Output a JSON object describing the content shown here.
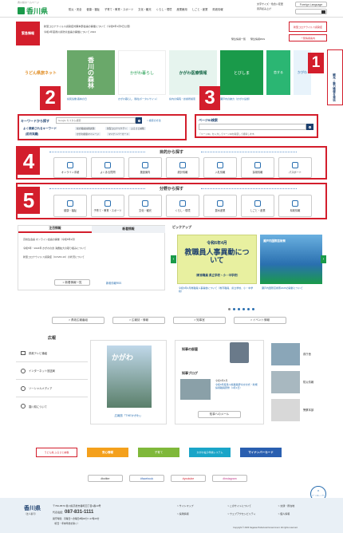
{
  "header": {
    "logo_text": "香川県",
    "site_name": "香川県ホームページ",
    "nav": [
      "防災・安全",
      "健康・福祉",
      "子育て・教育・スポーツ",
      "文化・観光",
      "くらし・環境",
      "産業雇用",
      "しごと・産業",
      "県政情報"
    ],
    "util": [
      "文字サイズ・色合い変更",
      "音声読み上げ",
      "サイトマップ"
    ],
    "lang_label": "Foreign Language",
    "search_label": "検索"
  },
  "emergency": {
    "badge": "緊急情報",
    "lines": [
      "新型コロナウイルス感染症対策本部会議の開催について（令和5年1月5日公表）",
      "令和4年度香川県防災会議の開催について 2024"
    ],
    "list_link": "緊急情報一覧",
    "rss_link": "緊急情報RSS",
    "side_button": "新型コロナウイルス感染症",
    "side_button2": "一覧情報案内"
  },
  "banners": [
    {
      "label": "うどん県旅ネット",
      "caption": "",
      "color": "#ffffff"
    },
    {
      "label": "香川の森林",
      "caption": "県民協働 森林の日",
      "color": "#6aa86a"
    },
    {
      "label": "かがわ暮らし",
      "caption": "かがわ暮らし（移住ポータルサイト）",
      "color": "#ffffff"
    },
    {
      "label": "かがわ医療情報",
      "caption": "県内の病院・診療所検索",
      "color": "#e6f4ee"
    },
    {
      "label": "とびしま",
      "caption": "瀬戸内の魅力（かがわ島旅）",
      "color": "#1a9a4a"
    },
    {
      "label": "恋する",
      "caption": "恋愛 結婚 子育てポータルサイト LOVEかがわ",
      "color": "#2bb673"
    },
    {
      "label": "かがわ",
      "caption": "ワクワクかがわ",
      "color": "#e8f3fb"
    }
  ],
  "keyword_search": {
    "title": "キーワードから探す",
    "placeholder": "Google カスタム検索",
    "hint": "> 検索の方法",
    "popular_label": "よく検索されるキーワード",
    "popular_sub": "(前月実績)",
    "popular": [
      "県の職員採用試験",
      "新型コロナワクチン",
      "ふるさと納税",
      "かがわ健康マイレージ",
      "マイナンバーカード"
    ]
  },
  "page_id_search": {
    "title": "ページID検索",
    "placeholder": "",
    "hint": "「ページID」を入力してページIDを指定して検索します。"
  },
  "purpose": {
    "title": "目的から探す",
    "items": [
      "オンライン手続",
      "よくある質問",
      "施設案内",
      "統計情報",
      "入札情報",
      "採用情報",
      "パスポート"
    ]
  },
  "field": {
    "title": "分野から探す",
    "items": [
      "健康・福祉",
      "子育て・教育・スポーツ",
      "文化・観光",
      "くらし・環境",
      "農水産業",
      "しごと・産業",
      "県政情報"
    ]
  },
  "news": {
    "tabs": [
      "注目情報",
      "新着情報"
    ],
    "items": [
      "高校生会議 オンライン会議の開催（令和5年1月）",
      "令和5年・2024年 かがわの食 消費拡大の取り組みについて",
      "新型コロナウイルス感染症（COVID-19）の状況について"
    ],
    "list_button": "> 新着情報一覧",
    "rss_button": "新着情報RSS"
  },
  "pickup": {
    "title": "ピックアップ",
    "slide_title1": "令和6年4月",
    "slide_title2": "教職員人事異動について",
    "slide_sub": "（教育職員 県立学校・小・中学校）",
    "slide_caption": "令和6年4月教職員人事異動について（教育職員、県立学校、小・中学校）",
    "slide2_caption": "瀬戸内国際芸術祭2025の開催について",
    "slide2_banner": "瀬戸内国際芸術祭",
    "tabs": [
      "> 県政広報番組",
      "> 広報誌・情報",
      "> 知事室",
      "> イベント情報"
    ]
  },
  "kouhou": {
    "title": "広報",
    "items": [
      "県政テレビ番組",
      "インターネット放送局",
      "ソーシャルメディア",
      "香川県について"
    ],
    "magazine_title": "かがわ",
    "magazine_caption": "広報誌「THEかがわ」",
    "governor_title": "知事の部屋",
    "blog_title": "知事ブログ",
    "blog_date": "令和6年4月",
    "blog_text": "令和6年度香川県職員辞令交付式・新規採用職員研修（4月1日）",
    "message_button": "知事へのメール",
    "right_items": [
      "県庁舎",
      "防災情報",
      "警察本部"
    ]
  },
  "footer_banners": [
    "うどん県 ふるさと納税",
    "安心情報",
    "子育て",
    "かがわ電子申請システム",
    "マイナンバーカード"
  ],
  "social_buttons": [
    "#twitter",
    "#facebook",
    "#youtube",
    "#instagram"
  ],
  "pagetop": "ページのトップへ",
  "footer": {
    "logo": "香川県",
    "sub": "（法人番号）",
    "address": "〒760-8570 香川県高松市番町四丁目1番10号",
    "tel_label": "代表電話：",
    "tel": "087-831-1111",
    "hours": "開庁時間：月曜日〜金曜日8時30分〜17時15分",
    "hours2": "（祝日・年末年始を除く）",
    "links": [
      "> サイトマップ",
      "> このサイトについて",
      "> 交通・所在地",
      "> 採用情報",
      "> ウェブアクセシビリティ",
      "> 個人情報"
    ],
    "copyright": "Copyright © 2023 Kagawa Prefectural Government. All rights reserved."
  },
  "annotations": [
    "1",
    "2",
    "3",
    "4",
    "5"
  ],
  "side_tab": "観光・魅力情報を発信",
  "colors": {
    "red": "#d31e2c",
    "blue": "#2a6fb0",
    "navy": "#1c3f6e",
    "green": "#1a9a4a"
  }
}
